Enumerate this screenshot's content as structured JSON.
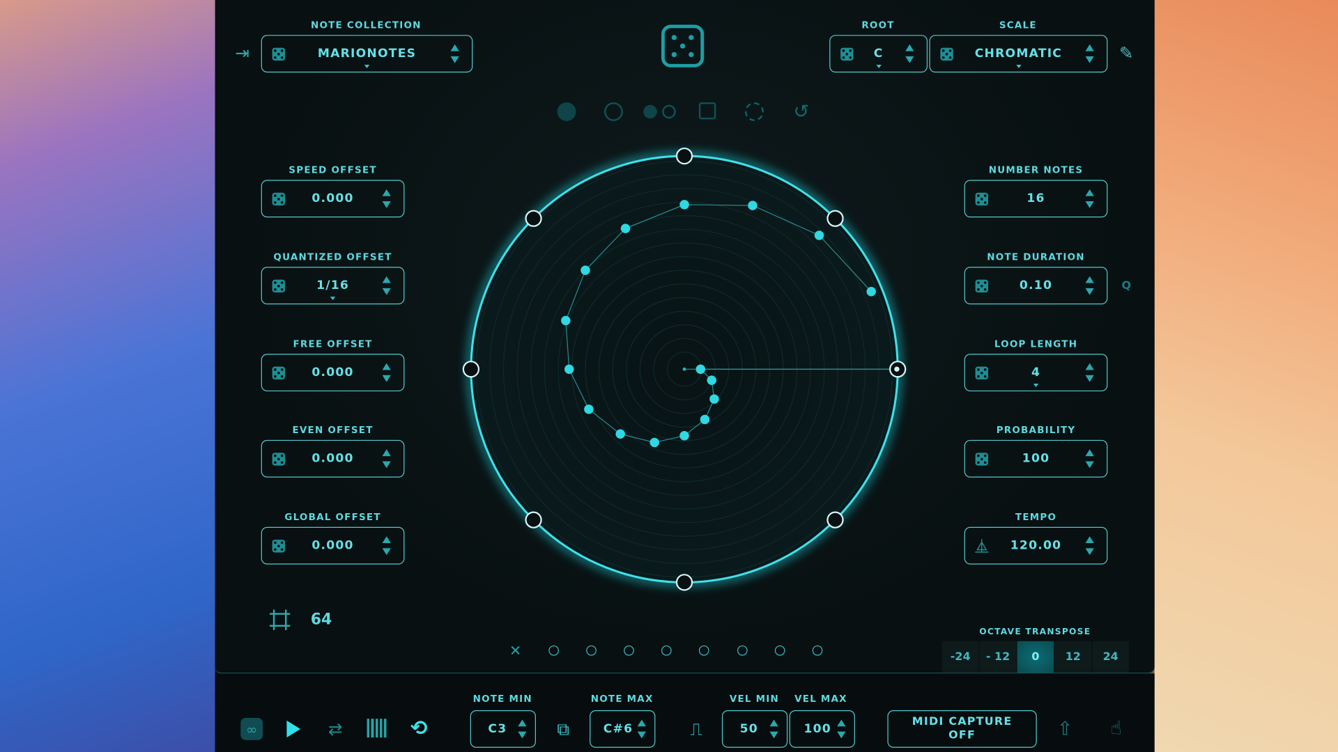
{
  "colors": {
    "accent": "#3fd6e0",
    "panel": "#0a1214",
    "icon": "#1d8f94"
  },
  "header": {
    "note_collection_label": "NOTE COLLECTION",
    "note_collection_value": "MARIONOTES",
    "root_label": "ROOT",
    "root_value": "C",
    "scale_label": "SCALE",
    "scale_value": "CHROMATIC"
  },
  "mode_icons": [
    "filled-circle-icon",
    "empty-circle-icon",
    "two-circles-icon",
    "random-square-icon",
    "dashed-circle-icon",
    "reset-icon"
  ],
  "left_fields": [
    {
      "label": "SPEED OFFSET",
      "value": "0.000"
    },
    {
      "label": "QUANTIZED OFFSET",
      "value": "1/16",
      "dropdown": true
    },
    {
      "label": "FREE OFFSET",
      "value": "0.000"
    },
    {
      "label": "EVEN OFFSET",
      "value": "0.000"
    },
    {
      "label": "GLOBAL OFFSET",
      "value": "0.000"
    }
  ],
  "right_fields": [
    {
      "label": "NUMBER NOTES",
      "value": "16"
    },
    {
      "label": "NOTE DURATION",
      "value": "0.10"
    },
    {
      "label": "LOOP LENGTH",
      "value": "4",
      "dropdown": true
    },
    {
      "label": "PROBABILITY",
      "value": "100"
    },
    {
      "label": "TEMPO",
      "value": "120.00",
      "icon": "metronome"
    }
  ],
  "quantize_toggle": "Q",
  "grid": {
    "value": "64"
  },
  "slots": {
    "clear": "✕",
    "count": 8
  },
  "octave_transpose": {
    "label": "OCTAVE TRANSPOSE",
    "options": [
      "-24",
      "- 12",
      "0",
      "12",
      "24"
    ],
    "selected": "0"
  },
  "bottom": {
    "note_min_label": "NOTE MIN",
    "note_min": "C3",
    "note_max_label": "NOTE MAX",
    "note_max": "C#6",
    "vel_min_label": "VEL MIN",
    "vel_min": "50",
    "vel_max_label": "VEL MAX",
    "vel_max": "100",
    "midi_capture_line1": "MIDI CAPTURE",
    "midi_capture_line2": "OFF"
  }
}
